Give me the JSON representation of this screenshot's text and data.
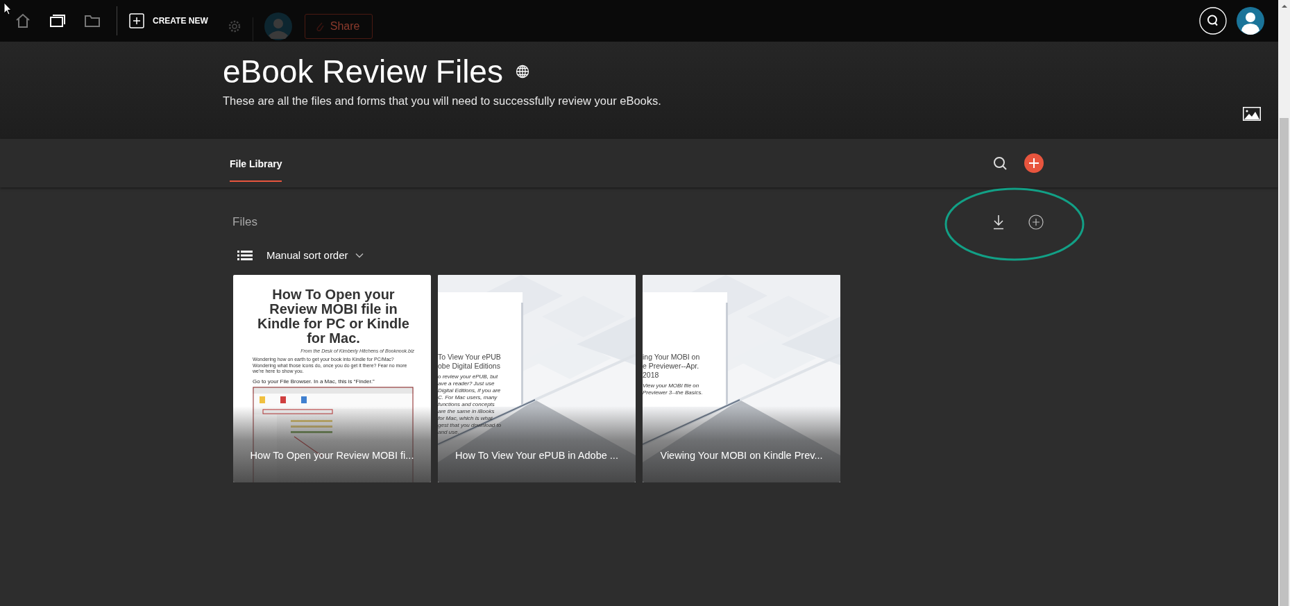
{
  "top_bar": {
    "nav_icons": [
      {
        "kind": "home",
        "selected": false
      },
      {
        "kind": "windows",
        "selected": true
      },
      {
        "kind": "folder",
        "selected": false
      }
    ],
    "create_button": "CREATE NEW",
    "share_button": "Share"
  },
  "header": {
    "title": "eBook Review Files",
    "subtitle": "These are all the files and forms that you will need to successfully review your eBooks."
  },
  "tabs": [
    {
      "label": "File Library",
      "selected": true
    }
  ],
  "files_section": {
    "heading": "Files",
    "sort_label": "Manual sort order"
  },
  "files": [
    {
      "kind": "page",
      "caption": "How To Open your Review MOBI fi...",
      "thumbnail": {
        "heading": "How To Open your Review MOBI file in Kindle for PC or Kindle for Mac.",
        "byline": "From the Desk of Kimberly Hitchens of Booknook.biz",
        "intro": "Wondering how on earth to get your book into Kindle for PC/Mac?Wondering what those icons do, once you do get it there? Fear no more we're here to show you.",
        "step": "Go to your File Browser. In a Mac, this is “Finder.”"
      }
    },
    {
      "kind": "cover",
      "caption": "How To View Your ePUB in Adobe ...",
      "thumbnail": {
        "heading_lines": [
          "To View Your ePUB",
          "obe Digital Editions"
        ],
        "body_lines": [
          "o review your ePUB, but",
          "ave a reader? Just use",
          "Digital Editions, if you are",
          "C. For Mac users, many",
          "functions and concepts",
          "are the same in iBooks",
          "for Mac, which is what",
          "gest that you download to",
          "and use."
        ]
      }
    },
    {
      "kind": "cover",
      "caption": "Viewing Your MOBI on Kindle Prev...",
      "thumbnail": {
        "heading_lines": [
          "ing Your MOBI on",
          "e Previewer--Apr.",
          "2018"
        ],
        "body_lines": [
          "View your MOBI file on",
          "Previewer 3--the Basics."
        ]
      }
    }
  ]
}
